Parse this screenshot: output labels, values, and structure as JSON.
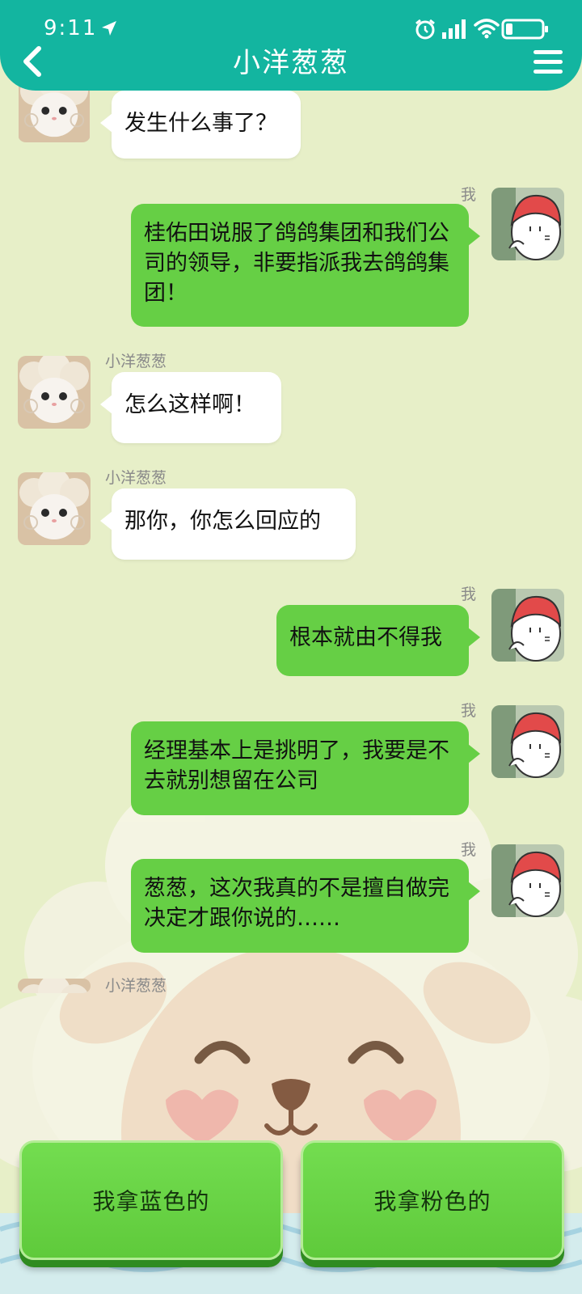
{
  "status_bar": {
    "time": "9:11"
  },
  "header": {
    "title": "小洋葱葱"
  },
  "messages": [
    {
      "side": "left",
      "sender": "",
      "text": "发生什么事了？"
    },
    {
      "side": "right",
      "sender": "我",
      "text": "桂佑田说服了鸽鸽集团和我们公司的领导，非要指派我去鸽鸽集团！"
    },
    {
      "side": "left",
      "sender": "小洋葱葱",
      "text": "怎么这样啊！"
    },
    {
      "side": "left",
      "sender": "小洋葱葱",
      "text": "那你，你怎么回应的"
    },
    {
      "side": "right",
      "sender": "我",
      "text": "根本就由不得我"
    },
    {
      "side": "right",
      "sender": "我",
      "text": "经理基本上是挑明了，我要是不去就别想留在公司"
    },
    {
      "side": "right",
      "sender": "我",
      "text": "葱葱，这次我真的不是擅自做完决定才跟你说的……"
    },
    {
      "side": "left",
      "sender": "小洋葱葱",
      "text": ""
    }
  ],
  "choices": [
    {
      "label": "我拿蓝色的"
    },
    {
      "label": "我拿粉色的"
    }
  ],
  "colors": {
    "header": "#13b5a0",
    "background": "#e7efc8",
    "bubble_right": "#66cf45",
    "bubble_left": "#ffffff",
    "choice_button": "#66d444"
  },
  "icons": [
    "location-arrow-icon",
    "alarm-icon",
    "signal-icon",
    "wifi-icon",
    "battery-icon",
    "back-chevron-icon",
    "menu-icon"
  ]
}
